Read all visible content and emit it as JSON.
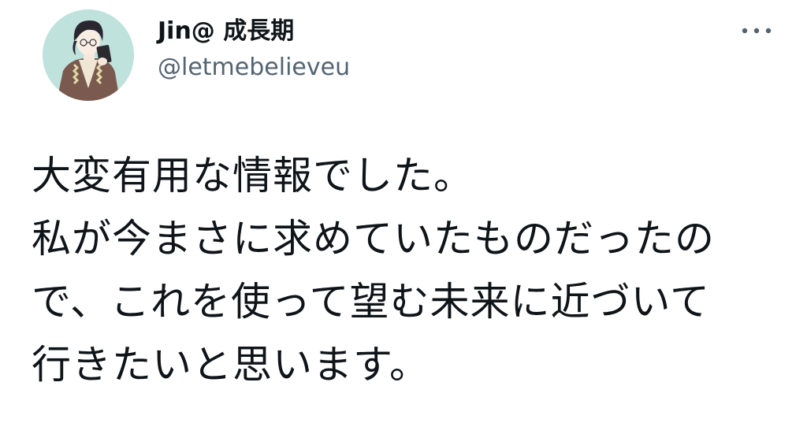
{
  "tweet": {
    "author": {
      "display_name": "Jin@ 成長期",
      "handle": "@letmebelieveu",
      "avatar_icon": "illustrated-character-avatar"
    },
    "more_icon": "more-horizontal-icon",
    "text_lines": [
      "大変有用な情報でした。",
      "私が今まさに求めていたものだったの",
      "で、これを使って望む未来に近づいて",
      "行きたいと思います。"
    ]
  },
  "colors": {
    "text_primary": "#0f1419",
    "text_secondary": "#536471",
    "avatar_background": "#bfe2dd"
  }
}
